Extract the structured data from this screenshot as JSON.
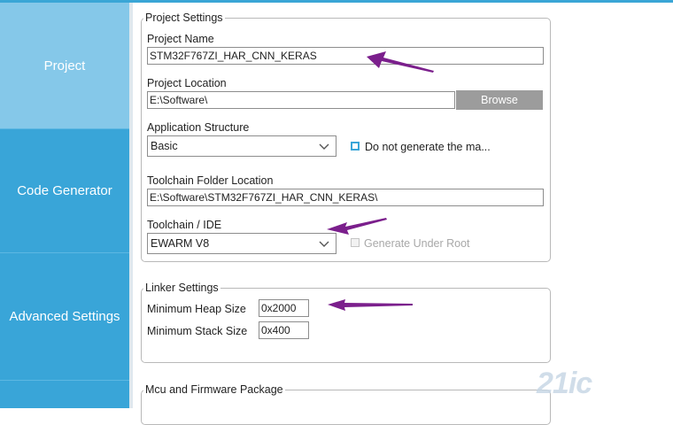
{
  "sidebar": {
    "items": [
      {
        "label": "Project",
        "active": true
      },
      {
        "label": "Code Generator",
        "active": false
      },
      {
        "label": "Advanced Settings",
        "active": false
      }
    ]
  },
  "project_settings": {
    "legend": "Project Settings",
    "project_name_label": "Project Name",
    "project_name_value": "STM32F767ZI_HAR_CNN_KERAS",
    "project_location_label": "Project Location",
    "project_location_value": "E:\\Software\\",
    "browse_label": "Browse",
    "app_structure_label": "Application Structure",
    "app_structure_value": "Basic",
    "do_not_generate_label": "Do not generate the ma...",
    "toolchain_folder_label": "Toolchain Folder Location",
    "toolchain_folder_value": "E:\\Software\\STM32F767ZI_HAR_CNN_KERAS\\",
    "toolchain_ide_label": "Toolchain / IDE",
    "toolchain_ide_value": "EWARM V8",
    "generate_under_root_label": "Generate Under Root"
  },
  "linker_settings": {
    "legend": "Linker Settings",
    "min_heap_label": "Minimum Heap Size",
    "min_heap_value": "0x2000",
    "min_stack_label": "Minimum Stack Size",
    "min_stack_value": "0x400"
  },
  "mcu_firmware": {
    "legend": "Mcu and Firmware Package"
  },
  "watermark": "21ic",
  "colors": {
    "sidebar": "#39a5d8",
    "sidebar_active": "#85c8e9",
    "button": "#9c9c9c",
    "arrow": "#7b1f8c",
    "checkbox": "#39a5d8"
  }
}
